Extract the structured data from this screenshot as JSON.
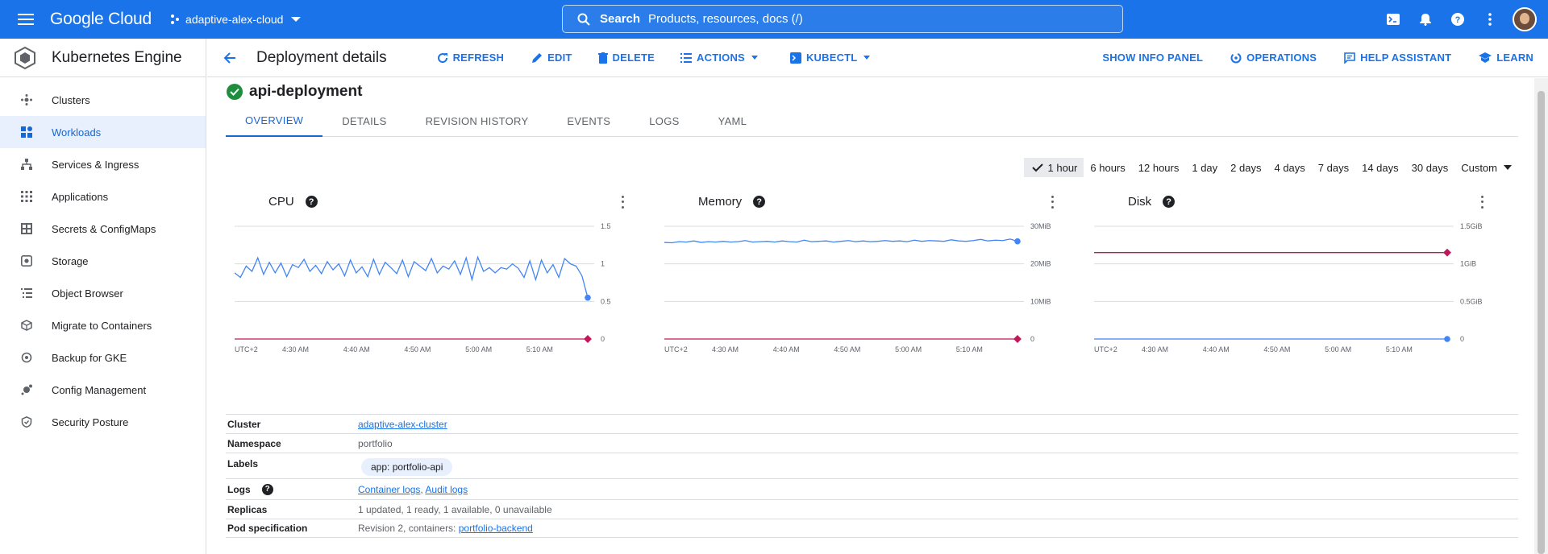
{
  "topbar": {
    "brand": "Google Cloud",
    "project": "adaptive-alex-cloud",
    "search_label": "Search",
    "search_placeholder": "Products, resources, docs (/)"
  },
  "sidebar": {
    "product": "Kubernetes Engine",
    "items": [
      {
        "label": "Clusters",
        "icon": "clusters-icon"
      },
      {
        "label": "Workloads",
        "icon": "workloads-icon",
        "active": true
      },
      {
        "label": "Services & Ingress",
        "icon": "services-icon"
      },
      {
        "label": "Applications",
        "icon": "applications-icon"
      },
      {
        "label": "Secrets & ConfigMaps",
        "icon": "secrets-icon"
      },
      {
        "label": "Storage",
        "icon": "storage-icon"
      },
      {
        "label": "Object Browser",
        "icon": "object-browser-icon"
      },
      {
        "label": "Migrate to Containers",
        "icon": "migrate-icon"
      },
      {
        "label": "Backup for GKE",
        "icon": "backup-icon"
      },
      {
        "label": "Config Management",
        "icon": "config-management-icon"
      },
      {
        "label": "Security Posture",
        "icon": "security-posture-icon"
      }
    ]
  },
  "header": {
    "title": "Deployment details",
    "refresh": "REFRESH",
    "edit": "EDIT",
    "delete": "DELETE",
    "actions": "ACTIONS",
    "kubectl": "KUBECTL",
    "show_info_panel": "SHOW INFO PANEL",
    "operations": "OPERATIONS",
    "help_assistant": "HELP ASSISTANT",
    "learn": "LEARN"
  },
  "resource": {
    "name": "api-deployment",
    "status": "ok"
  },
  "tabs": [
    "OVERVIEW",
    "DETAILS",
    "REVISION HISTORY",
    "EVENTS",
    "LOGS",
    "YAML"
  ],
  "active_tab": "OVERVIEW",
  "time_ranges": [
    "1 hour",
    "6 hours",
    "12 hours",
    "1 day",
    "2 days",
    "4 days",
    "7 days",
    "14 days",
    "30 days",
    "Custom"
  ],
  "selected_time_range": "1 hour",
  "colors": {
    "accent": "#1a73e8",
    "usage_series": "#4285f4",
    "limit_series": "#c2185b",
    "ok": "#1e8e3e"
  },
  "chart_data": [
    {
      "type": "line",
      "title": "CPU",
      "x_ticks": [
        "UTC+2",
        "4:30 AM",
        "4:40 AM",
        "4:50 AM",
        "5:00 AM",
        "5:10 AM"
      ],
      "y_ticks": [
        "0",
        "0.5",
        "1",
        "1.5"
      ],
      "ylim": [
        0,
        1.5
      ],
      "grid": true,
      "series": [
        {
          "color": "#4285f4",
          "values": [
            0.88,
            0.82,
            0.97,
            0.9,
            1.08,
            0.86,
            1.02,
            0.88,
            1.01,
            0.83,
            0.99,
            0.95,
            1.06,
            0.9,
            0.98,
            0.87,
            1.03,
            0.92,
            1.0,
            0.84,
            1.05,
            0.88,
            0.96,
            0.83,
            1.06,
            0.86,
            1.02,
            0.95,
            0.87,
            1.05,
            0.83,
            1.03,
            0.97,
            0.91,
            1.07,
            0.88,
            0.97,
            0.93,
            1.04,
            0.86,
            1.08,
            0.79,
            1.09,
            0.9,
            0.95,
            0.88,
            0.95,
            0.93,
            1.0,
            0.94,
            0.82,
            1.04,
            0.79,
            1.05,
            0.88,
            0.99,
            0.82,
            1.07,
            1.0,
            0.97,
            0.84,
            0.55
          ]
        },
        {
          "color": "#c2185b",
          "values": [
            0,
            0,
            0,
            0,
            0,
            0,
            0,
            0,
            0,
            0,
            0,
            0
          ]
        }
      ]
    },
    {
      "type": "line",
      "title": "Memory",
      "x_ticks": [
        "UTC+2",
        "4:30 AM",
        "4:40 AM",
        "4:50 AM",
        "5:00 AM",
        "5:10 AM"
      ],
      "y_ticks": [
        "0",
        "10MiB",
        "20MiB",
        "30MiB"
      ],
      "ylim": [
        0,
        30
      ],
      "grid": true,
      "series": [
        {
          "color": "#4285f4",
          "values": [
            25.7,
            25.6,
            25.9,
            25.8,
            26.1,
            25.7,
            25.9,
            25.8,
            26.0,
            25.8,
            25.9,
            26.2,
            25.8,
            25.9,
            26.0,
            25.8,
            26.1,
            25.9,
            25.8,
            26.3,
            25.9,
            26.0,
            26.1,
            25.8,
            26.0,
            26.2,
            25.9,
            26.1,
            25.9,
            26.0,
            26.2,
            26.0,
            26.1,
            25.9,
            26.3,
            26.0,
            26.2,
            26.1,
            26.0,
            26.4,
            26.1,
            26.0,
            26.2,
            26.5,
            26.1,
            26.3,
            26.2,
            26.6,
            26.0
          ]
        },
        {
          "color": "#c2185b",
          "values": [
            0,
            0,
            0,
            0,
            0,
            0,
            0,
            0,
            0,
            0,
            0,
            0
          ]
        }
      ]
    },
    {
      "type": "line",
      "title": "Disk",
      "x_ticks": [
        "UTC+2",
        "4:30 AM",
        "4:40 AM",
        "4:50 AM",
        "5:00 AM",
        "5:10 AM"
      ],
      "y_ticks": [
        "0",
        "0.5GiB",
        "1GiB",
        "1.5GiB"
      ],
      "ylim": [
        0,
        1.5
      ],
      "grid": true,
      "series": [
        {
          "color": "#c2185b",
          "values": [
            1.15,
            1.15,
            1.15,
            1.15,
            1.15,
            1.15,
            1.15,
            1.15,
            1.15,
            1.15,
            1.15,
            1.15
          ]
        },
        {
          "color": "#4285f4",
          "values": [
            0,
            0,
            0,
            0,
            0,
            0,
            0,
            0,
            0,
            0,
            0,
            0
          ]
        }
      ]
    }
  ],
  "details": {
    "cluster_label": "Cluster",
    "cluster_value": "adaptive-alex-cluster",
    "namespace_label": "Namespace",
    "namespace_value": "portfolio",
    "labels_label": "Labels",
    "labels_value": "app: portfolio-api",
    "logs_label": "Logs",
    "logs_container": "Container logs",
    "logs_sep": ",",
    "logs_audit": "Audit logs",
    "replicas_label": "Replicas",
    "replicas_value": "1 updated, 1 ready, 1 available, 0 unavailable",
    "podspec_label": "Pod specification",
    "podspec_prefix": "Revision 2, containers:",
    "podspec_container": "portfolio-backend"
  }
}
